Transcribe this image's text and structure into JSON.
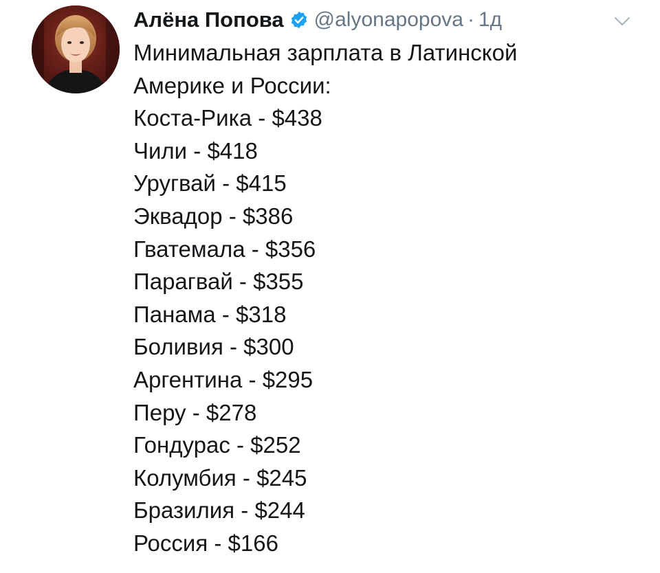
{
  "tweet": {
    "author_name": "Алёна Попова",
    "handle": "@alyonapopova",
    "separator": "·",
    "time": "1д",
    "verified_icon": "verified-badge-icon",
    "menu_icon": "chevron-down-icon",
    "intro_lines": [
      "Минимальная зарплата в Латинской",
      "Америке и России:"
    ],
    "items": [
      "Коста-Рика - $438",
      "Чили - $418",
      "Уругвай - $415",
      "Эквадор - $386",
      "Гватемала - $356",
      "Парагвай - $355",
      "Панама - $318",
      "Боливия - $300",
      "Аргентина - $295",
      "Перу - $278",
      "Гондурас - $252",
      "Колумбия - $245",
      "Бразилия - $244",
      "Россия - $166"
    ]
  },
  "colors": {
    "text": "#14171a",
    "secondary": "#657786",
    "verified": "#1da1f2",
    "caret": "#aab8c2"
  }
}
